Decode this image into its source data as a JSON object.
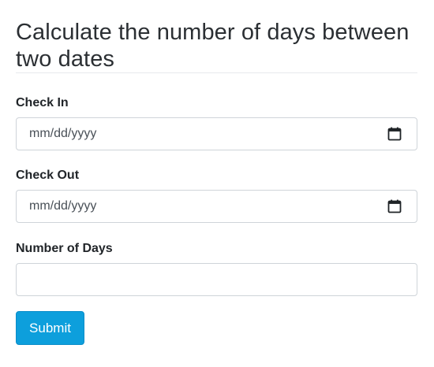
{
  "page": {
    "title": "Calculate the number of days between two dates"
  },
  "form": {
    "check_in": {
      "label": "Check In",
      "placeholder": "mm/dd/yyyy",
      "icon": "calendar-icon"
    },
    "check_out": {
      "label": "Check Out",
      "placeholder": "mm/dd/yyyy",
      "icon": "calendar-icon"
    },
    "number_of_days": {
      "label": "Number of Days",
      "value": ""
    },
    "submit_label": "Submit"
  },
  "colors": {
    "primary": "#0d9fdc",
    "border": "#cfd4d9",
    "text": "#212529"
  }
}
